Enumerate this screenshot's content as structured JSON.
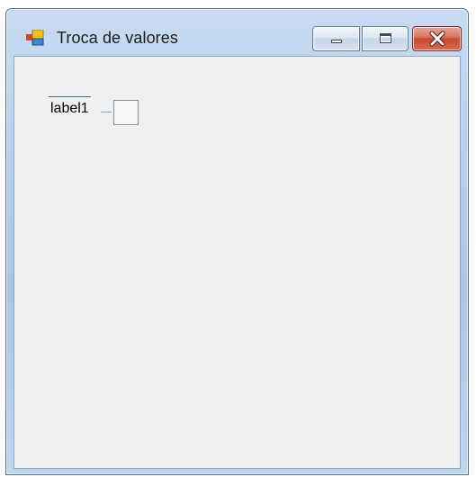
{
  "window": {
    "title": "Troca de valores",
    "app_icon": "winforms-app-icon",
    "controls": {
      "minimize_icon": "minimize-icon",
      "maximize_icon": "maximize-icon",
      "close_icon": "close-icon"
    },
    "accent_colors": {
      "frame": "#b9d1ec",
      "close": "#c84a33",
      "client": "#f0f0f0"
    }
  },
  "form": {
    "label1_text": "label1"
  }
}
